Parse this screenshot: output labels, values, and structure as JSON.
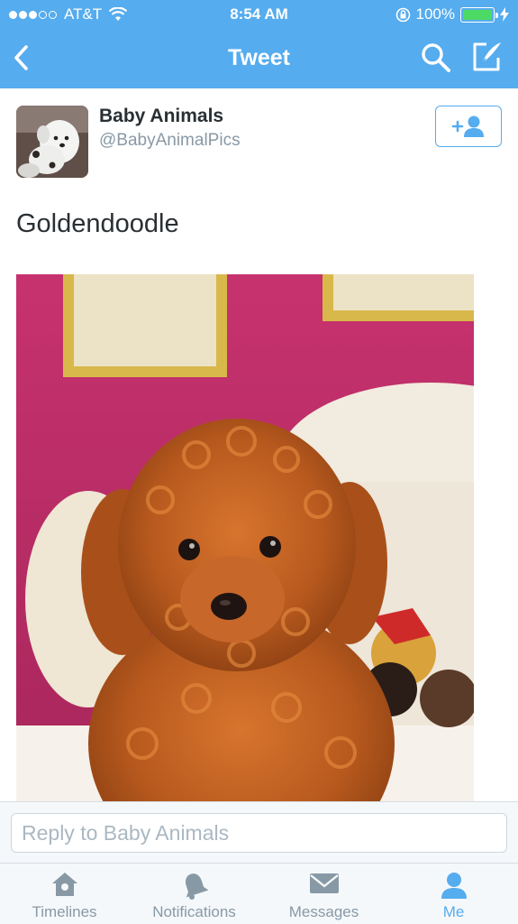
{
  "status_bar": {
    "carrier": "AT&T",
    "signal_bars": 3,
    "signal_total": 5,
    "time": "8:54 AM",
    "battery": "100%",
    "battery_level": 1.0
  },
  "nav": {
    "title": "Tweet",
    "back_icon": "chevron-left-icon",
    "search_icon": "search-icon",
    "compose_icon": "compose-icon"
  },
  "tweet": {
    "author_name": "Baby Animals",
    "author_handle": "@BabyAnimalPics",
    "follow_icon": "follow-user-icon",
    "text": "Goldendoodle"
  },
  "reply": {
    "placeholder": "Reply to Baby Animals"
  },
  "tabs": [
    {
      "label": "Timelines",
      "icon": "home-icon",
      "active": false
    },
    {
      "label": "Notifications",
      "icon": "bell-icon",
      "active": false
    },
    {
      "label": "Messages",
      "icon": "envelope-icon",
      "active": false
    },
    {
      "label": "Me",
      "icon": "person-icon",
      "active": true
    }
  ],
  "colors": {
    "brand": "#55acee",
    "text": "#292f33",
    "muted": "#8899a6",
    "battery": "#4cd964"
  }
}
